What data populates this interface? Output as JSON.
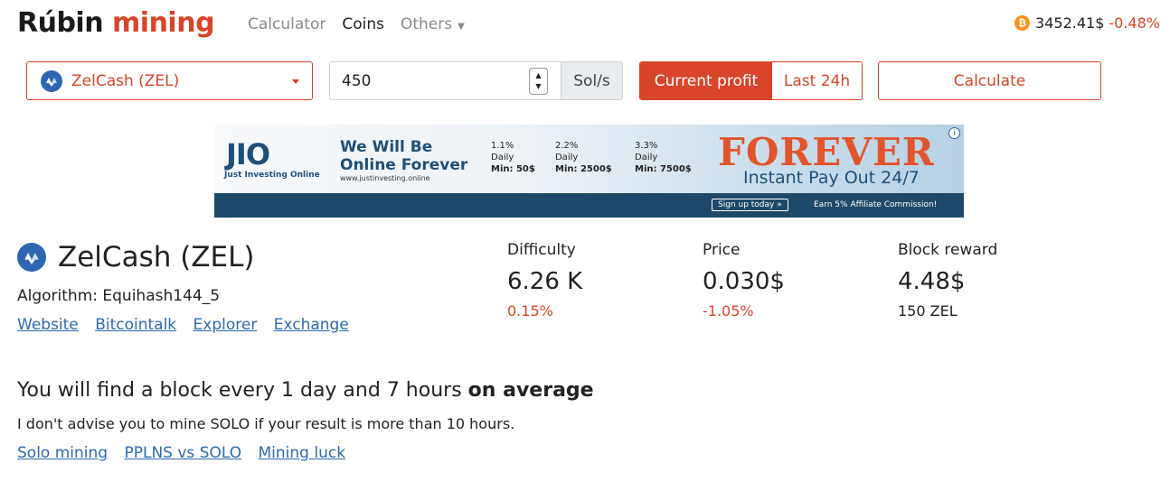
{
  "header": {
    "logo_part1": "Rúbin",
    "logo_part2": "mining",
    "nav": [
      {
        "label": "Calculator"
      },
      {
        "label": "Coins"
      },
      {
        "label": "Others"
      }
    ],
    "btc_price": "3452.41$",
    "btc_change": "-0.48%",
    "btc_icon": "bitcoin-icon"
  },
  "controls": {
    "coin_selected": "ZelCash (ZEL)",
    "hashrate_value": "450",
    "hashrate_unit": "Sol/s",
    "mode_current": "Current profit",
    "mode_24h": "Last 24h",
    "calculate_label": "Calculate"
  },
  "ad": {
    "jio_j": "JIO",
    "jio_sub": "Just Investing Online",
    "headline_1": "We Will Be",
    "headline_2": "Online Forever",
    "url": "www.justinvesting.online",
    "rates": [
      {
        "pct": "1.1%",
        "period": "Daily",
        "min": "Min: 50$"
      },
      {
        "pct": "2.2%",
        "period": "Daily",
        "min": "Min: 2500$"
      },
      {
        "pct": "3.3%",
        "period": "Daily",
        "min": "Min: 7500$"
      }
    ],
    "forever": "FOREVER",
    "payout": "Instant Pay Out 24/7",
    "signup": "Sign up today »",
    "affiliate": "Earn 5% Affiliate Commission!",
    "info_glyph": "i"
  },
  "coin": {
    "name": "ZelCash (ZEL)",
    "algorithm": "Algorithm: Equihash144_5",
    "links": [
      "Website",
      "Bitcointalk",
      "Explorer",
      "Exchange"
    ]
  },
  "stats": [
    {
      "label": "Difficulty",
      "value": "6.26 K",
      "sub": "0.15%"
    },
    {
      "label": "Price",
      "value": "0.030$",
      "sub": "-1.05%"
    },
    {
      "label": "Block reward",
      "value": "4.48$",
      "sub": "150 ZEL"
    }
  ],
  "block": {
    "title_prefix": "You will find a block every 1 day and 7 hours",
    "title_bold": "on average",
    "advice": "I don't advise you to mine SOLO if your result is more than 10 hours.",
    "links": [
      "Solo mining",
      "PPLNS vs SOLO",
      "Mining luck"
    ]
  },
  "colors": {
    "accent": "#d8452a",
    "link": "#2a6ab0",
    "coin_blue": "#2f66b3"
  }
}
